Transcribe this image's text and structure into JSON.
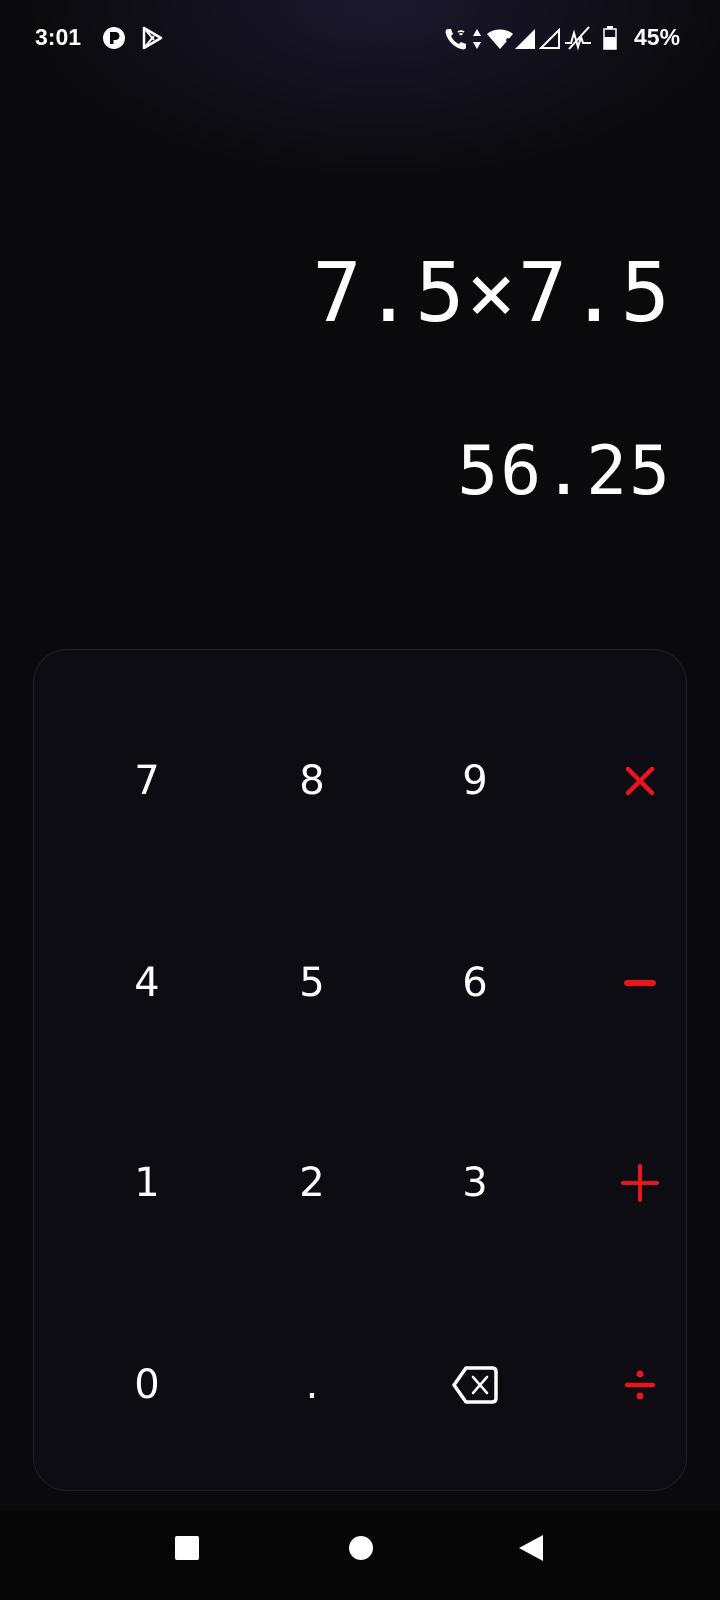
{
  "status_bar": {
    "time": "3:01",
    "battery_percent": "45%",
    "icons": [
      "app-notification-icon",
      "play-store-icon",
      "wifi-calling-icon",
      "data-arrows-icon",
      "wifi-icon",
      "signal-full-icon",
      "signal-empty-icon",
      "no-signal-icon",
      "battery-icon"
    ]
  },
  "display": {
    "expression": "7.5×7.5",
    "result": "56.25"
  },
  "keypad": {
    "rows": [
      [
        {
          "label": "7",
          "type": "digit"
        },
        {
          "label": "8",
          "type": "digit"
        },
        {
          "label": "9",
          "type": "digit"
        },
        {
          "label": "",
          "type": "operator",
          "icon": "multiply-icon"
        }
      ],
      [
        {
          "label": "4",
          "type": "digit"
        },
        {
          "label": "5",
          "type": "digit"
        },
        {
          "label": "6",
          "type": "digit"
        },
        {
          "label": "",
          "type": "operator",
          "icon": "minus-icon"
        }
      ],
      [
        {
          "label": "1",
          "type": "digit"
        },
        {
          "label": "2",
          "type": "digit"
        },
        {
          "label": "3",
          "type": "digit"
        },
        {
          "label": "",
          "type": "operator",
          "icon": "plus-icon"
        }
      ],
      [
        {
          "label": "0",
          "type": "digit"
        },
        {
          "label": ".",
          "type": "digit"
        },
        {
          "label": "",
          "type": "action",
          "icon": "backspace-icon"
        },
        {
          "label": "",
          "type": "operator",
          "icon": "divide-icon"
        }
      ]
    ]
  },
  "nav_bar": {
    "buttons": [
      "recents-square-icon",
      "home-circle-icon",
      "back-triangle-icon"
    ]
  },
  "colors": {
    "background": "#0a0a0c",
    "keypad_background": "#0c0c12",
    "operator_accent": "#e8161c",
    "text": "#ffffff"
  }
}
